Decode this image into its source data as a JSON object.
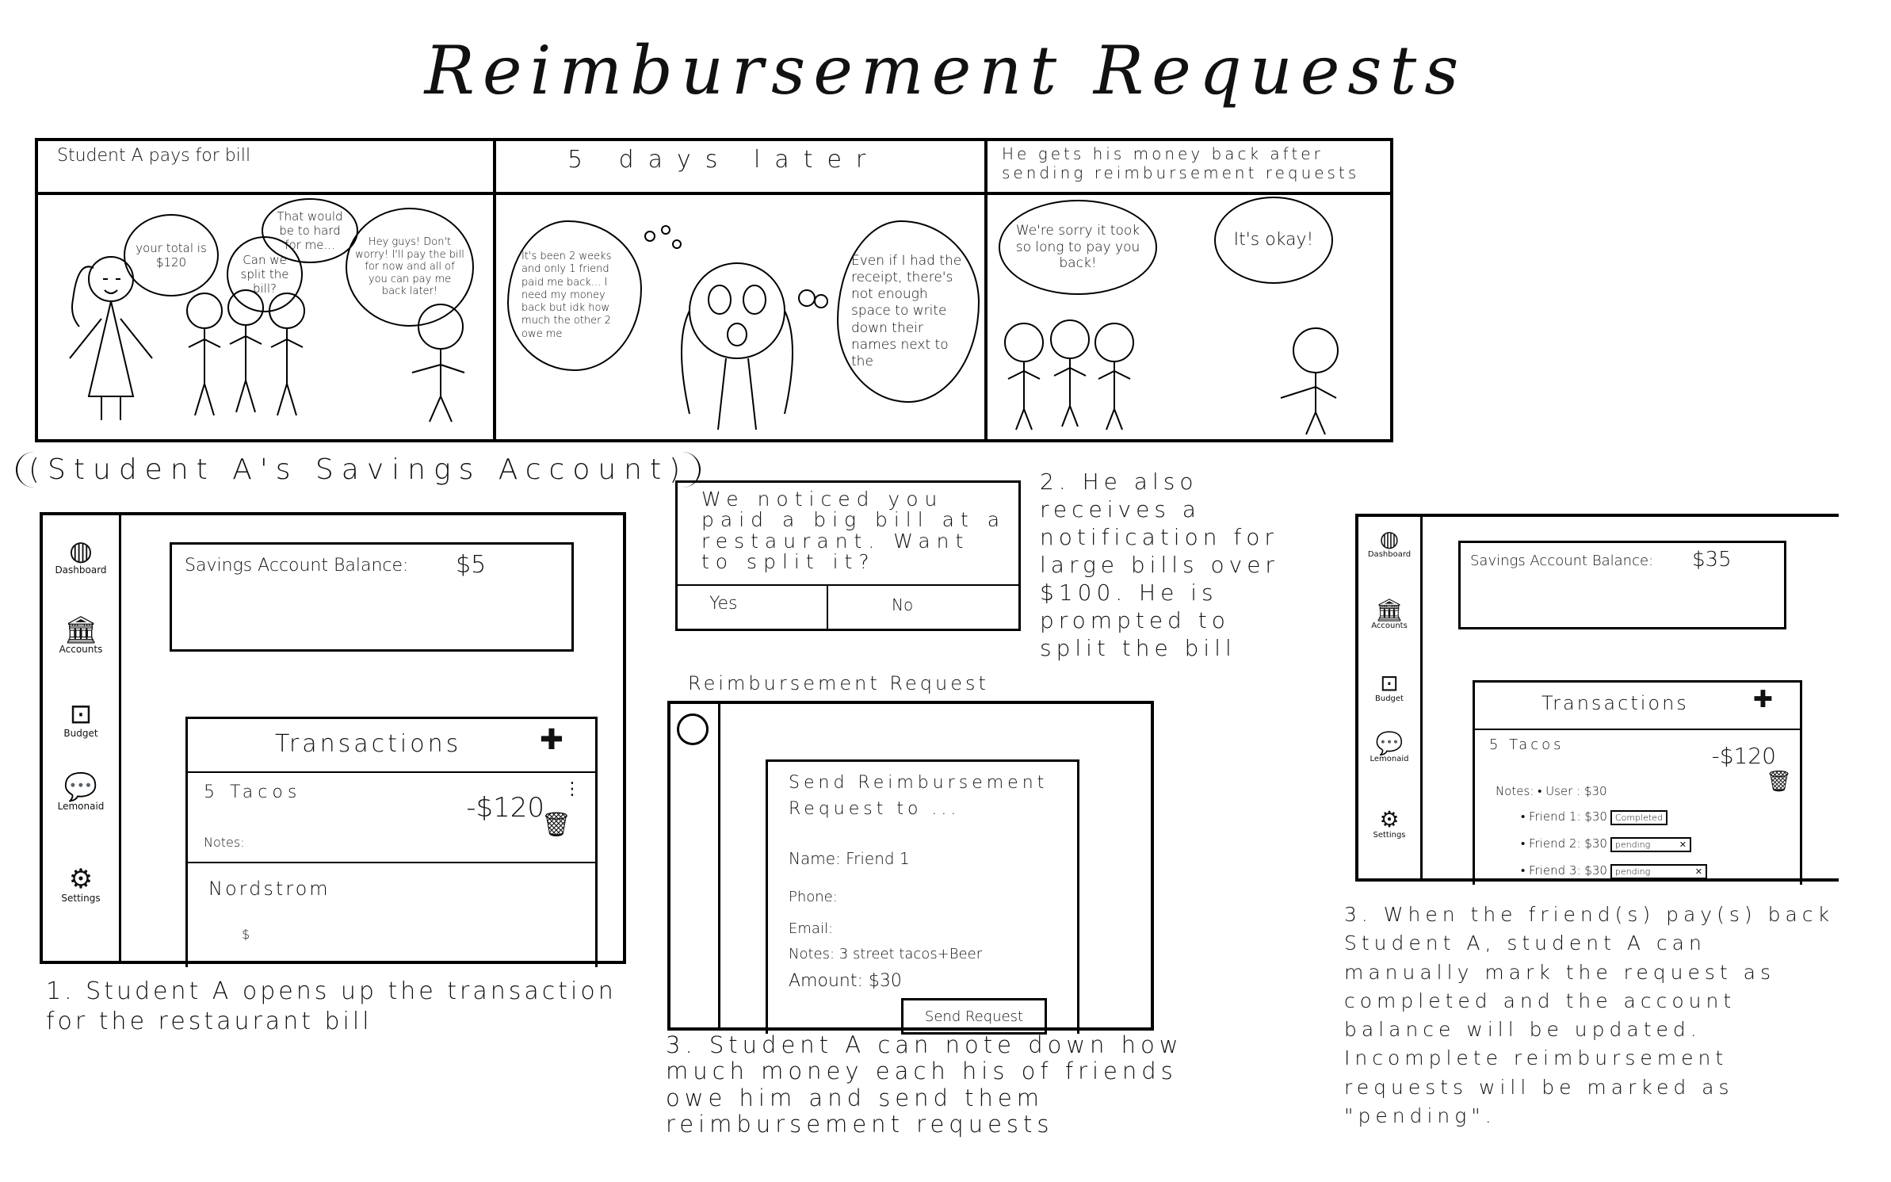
{
  "title": "Reimbursement Requests",
  "strip": {
    "panel1": {
      "caption": "Student A pays for bill",
      "bubble_cashier": "your total is $120",
      "bubble_split": "Can we split the bill?",
      "bubble_hard": "That would be to hard for me...",
      "bubble_studentA": "Hey guys! Don't worry! I'll pay the bill for now and all of you can pay me back later!"
    },
    "panel2": {
      "caption": "5 days later",
      "thought_left": "It's been 2 weeks and only 1 friend paid me back... I need my money back but idk how much the other 2 owe me",
      "thought_right": "Even if I had the receipt, there's not enough space to write down their names next to the"
    },
    "panel3": {
      "caption": "He gets his money back after sending reimbursement requests",
      "bubble_friends": "We're sorry it took so long to pay you back!",
      "bubble_studentA": "It's okay!"
    }
  },
  "savings_label": "(Student A's Savings Account)",
  "app1": {
    "nav": [
      "Dashboard",
      "Accounts",
      "Budget",
      "Lemonaid",
      "Settings"
    ],
    "balance_label": "Savings Account Balance:",
    "balance_value": "$5",
    "transactions_title": "Transactions",
    "tx_name": "5 Tacos",
    "tx_amount": "-$120",
    "tx_notes_label": "Notes:",
    "tx2_name": "Nordstrom",
    "tx2_amount": "$"
  },
  "caption1": "1. Student A opens up the transaction for the restaurant bill",
  "popup": {
    "message": "We noticed you paid a big bill at a restaurant. Want to split it?",
    "yes": "Yes",
    "no": "No"
  },
  "caption2": "2. He also receives a notification for large bills over $100. He is prompted to split the bill",
  "request": {
    "heading": "Reimbursement Request",
    "form_title": "Send Reimbursement Request to ...",
    "name": "Name: Friend 1",
    "phone": "Phone:",
    "email": "Email:",
    "notes": "Notes: 3 street tacos+Beer",
    "amount": "Amount: $30",
    "send_button": "Send Request"
  },
  "caption3": "3. Student A can note down how much money each his of friends owe him and send them reimbursement requests",
  "app2": {
    "nav": [
      "Dashboard",
      "Accounts",
      "Budget",
      "Lemonaid",
      "Settings"
    ],
    "balance_label": "Savings Account Balance:",
    "balance_value": "$35",
    "transactions_title": "Transactions",
    "tx_name": "5 Tacos",
    "tx_amount": "-$120",
    "notes_user": "Notes: • User : $30",
    "friend1": "• Friend 1: $30",
    "friend1_status": "Completed",
    "friend2": "• Friend 2: $30",
    "friend2_status": "pending",
    "friend3": "• Friend 3: $30",
    "friend3_status": "pending"
  },
  "caption4": "3. When the friend(s) pay(s) back Student A, student A can manually mark the request as completed and the account balance will be updated. Incomplete reimbursement requests will be marked as \"pending\"."
}
